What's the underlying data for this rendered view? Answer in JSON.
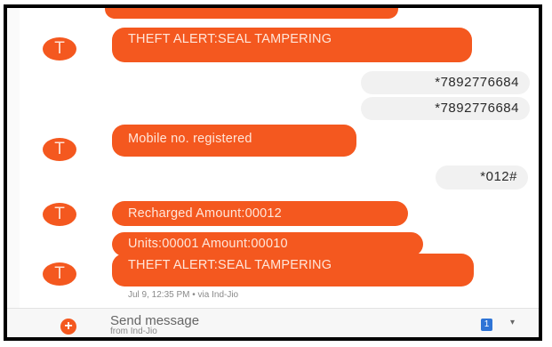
{
  "messages": [
    {
      "sender": "T",
      "text": "THEFT ALERT:SEAL TAMPERING",
      "direction": "incoming"
    },
    {
      "text": "*7892776684",
      "direction": "outgoing"
    },
    {
      "text": "*7892776684",
      "direction": "outgoing"
    },
    {
      "sender": "T",
      "text": "Mobile no. registered",
      "direction": "incoming"
    },
    {
      "text": "*012#",
      "direction": "outgoing"
    },
    {
      "sender": "T",
      "text": "Recharged Amount:00012",
      "direction": "incoming"
    },
    {
      "text": "Units:00001 Amount:00010",
      "direction": "incoming"
    },
    {
      "sender": "T",
      "text": "THEFT ALERT:SEAL TAMPERING",
      "direction": "incoming"
    }
  ],
  "last_timestamp": "Jul 9, 12:35 PM • via Ind-Jio",
  "compose": {
    "placeholder": "Send message",
    "subtext": "from Ind-Jio",
    "add_icon": "+",
    "sim_label": "1",
    "chevron": "▾"
  },
  "colors": {
    "incoming_bubble": "#f4581f",
    "outgoing_bubble": "#f1f1f1",
    "accent": "#f4581f"
  }
}
